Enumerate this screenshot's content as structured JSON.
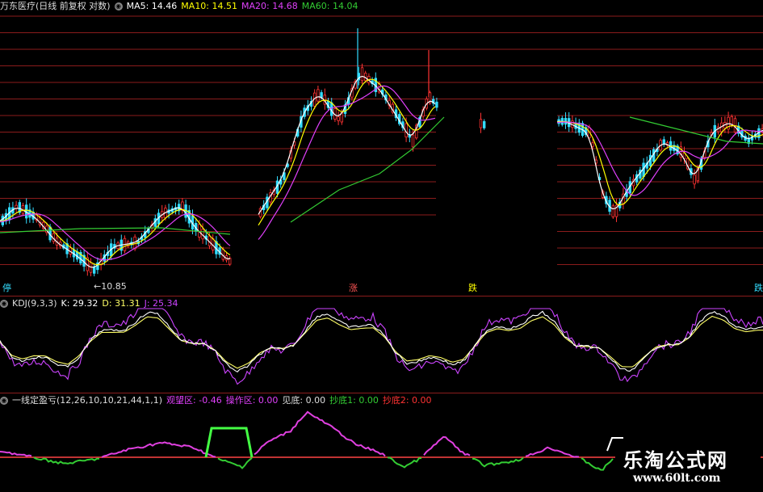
{
  "main_header": {
    "title": "万东医疗(日线 前复权 对数)",
    "ma5": "MA5: 14.46",
    "ma10": "MA10: 14.51",
    "ma20": "MA20: 14.68",
    "ma60": "MA60: 14.04"
  },
  "price_low_label": "10.85",
  "markers": {
    "left": "停",
    "zhang": "涨",
    "die": "跌",
    "right": "跌"
  },
  "kdj_header": {
    "name": "KDJ(9,3,3)",
    "k": "K: 29.32",
    "d": "D: 31.31",
    "j": "J: 25.34"
  },
  "indicator_header": {
    "name": "一线定盈亏(12,26,10,10,21,44,1,1)",
    "watch": "观望区: -0.46",
    "operate": "操作区: 0.00",
    "bottom": "见底: 0.00",
    "buy1": "抄底1: 0.00",
    "buy2": "抄底2: 0.00"
  },
  "watermark": {
    "cn": "乐淘公式网",
    "url": "www.60lt.com"
  },
  "colors": {
    "ma5": "#ffffff",
    "ma10": "#ffff00",
    "ma20": "#e040fb",
    "ma60": "#33cc33",
    "up": "#ff3333",
    "down": "#33ddff",
    "grid": "#8b1c1c",
    "kdj_k": "#ffffff",
    "kdj_d": "#ffff66",
    "kdj_j": "#cc44ff",
    "indicator_pink": "#e040e0",
    "indicator_green": "#33cc33"
  }
}
